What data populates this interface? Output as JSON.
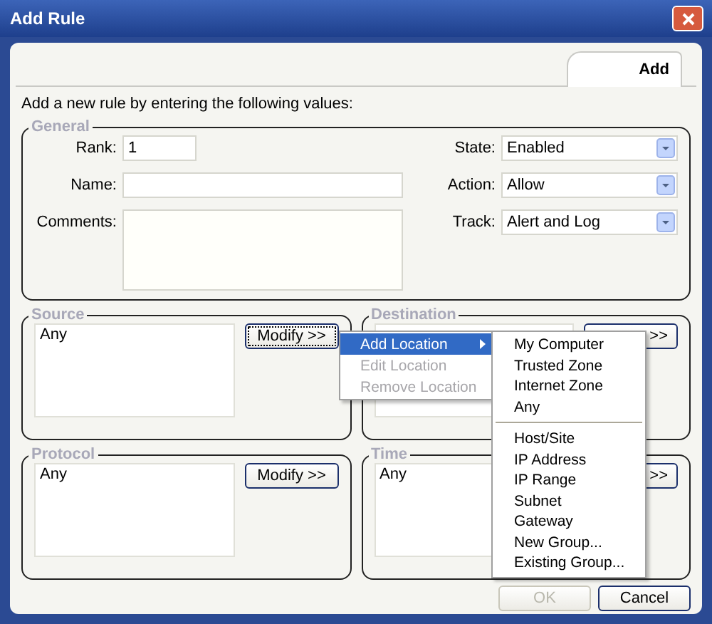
{
  "window": {
    "title": "Add Rule"
  },
  "tabs": [
    {
      "label": "Add",
      "selected": true
    }
  ],
  "intro": "Add a new rule by entering the following values:",
  "general": {
    "title": "General",
    "fields": [
      {
        "kind": "input",
        "label": "Rank:",
        "value": "1"
      },
      {
        "kind": "input",
        "label": "Name:"
      },
      {
        "kind": "textarea",
        "label": "Comments:"
      }
    ],
    "dropdowns": [
      {
        "label": "State:",
        "value": "Enabled"
      },
      {
        "label": "Action:",
        "value": "Allow"
      },
      {
        "label": "Track:",
        "value": "Alert and Log"
      }
    ]
  },
  "sections": [
    {
      "title": "Source",
      "items": [
        "Any"
      ],
      "button": "Modify >>",
      "focused": true
    },
    {
      "title": "Destination",
      "button": ">>",
      "focused": false
    },
    {
      "title": "Protocol",
      "items": [
        "Any"
      ],
      "button": "Modify >>",
      "focused": false
    },
    {
      "title": "Time",
      "items": [
        "Any"
      ],
      "button": ">>",
      "focused": false
    }
  ],
  "context_menu": [
    {
      "label": "Add Location",
      "selected": true,
      "disabled": false,
      "submenu": true
    },
    {
      "label": "Edit Location",
      "selected": false,
      "disabled": true,
      "submenu": false
    },
    {
      "label": "Remove Location",
      "selected": false,
      "disabled": true,
      "submenu": false
    }
  ],
  "submenu": [
    [
      "My Computer",
      "Trusted Zone",
      "Internet Zone",
      "Any"
    ],
    [
      "Host/Site",
      "IP Address",
      "IP Range",
      "Subnet",
      "Gateway",
      "New Group...",
      "Existing Group..."
    ]
  ],
  "buttons": [
    {
      "label": "OK",
      "disabled": true
    },
    {
      "label": "Cancel",
      "disabled": false
    }
  ]
}
